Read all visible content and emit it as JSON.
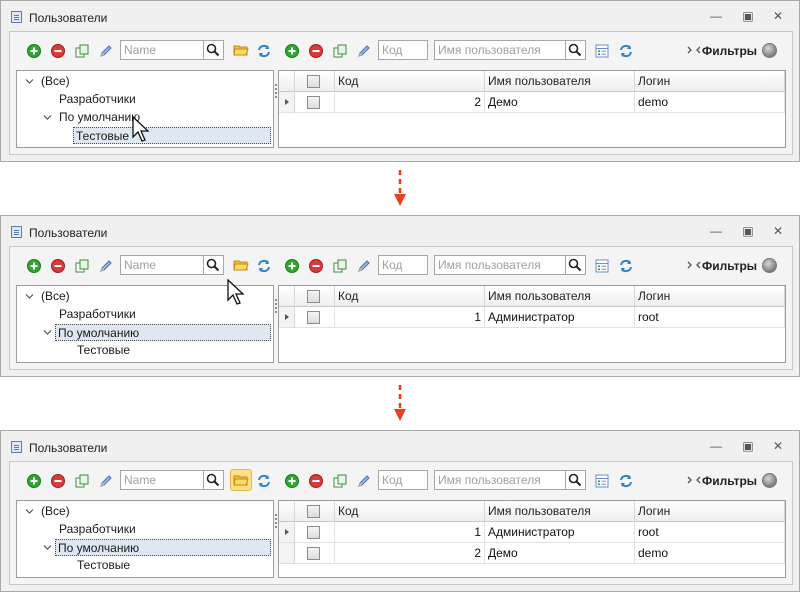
{
  "window_title": "Пользователи",
  "window_controls": [
    "minimize-icon",
    "restore-icon",
    "close-icon"
  ],
  "left_toolbar": {
    "search_placeholder": "Name",
    "icons": [
      "add-icon",
      "delete-icon",
      "copy-icon",
      "edit-icon",
      "search-icon",
      "folder-icon",
      "refresh-icon"
    ]
  },
  "right_toolbar": {
    "code_placeholder": "Код",
    "username_placeholder": "Имя пользователя",
    "filters_label": "Фильтры",
    "icons": [
      "add-icon",
      "delete-icon",
      "copy-icon",
      "edit-icon",
      "search-icon",
      "columns-icon",
      "refresh-icon",
      "collapse-icon",
      "status-ball-icon"
    ]
  },
  "tree": {
    "all": "(Все)",
    "developers": "Разработчики",
    "default": "По умолчанию",
    "test": "Тестовые"
  },
  "grid": {
    "columns": [
      "Код",
      "Имя пользователя",
      "Логин"
    ]
  },
  "screens": [
    {
      "selected_tree_item": "Тестовые",
      "folder_button_highlighted": false,
      "rows": [
        {
          "code": "2",
          "name": "Демо",
          "login": "demo"
        }
      ]
    },
    {
      "selected_tree_item": "По умолчанию",
      "folder_button_highlighted": false,
      "rows": [
        {
          "code": "1",
          "name": "Администратор",
          "login": "root"
        }
      ]
    },
    {
      "selected_tree_item": "По умолчанию",
      "folder_button_highlighted": true,
      "rows": [
        {
          "code": "1",
          "name": "Администратор",
          "login": "root"
        },
        {
          "code": "2",
          "name": "Демо",
          "login": "demo"
        }
      ]
    }
  ],
  "colors": {
    "add": "#2fa62f",
    "delete": "#d93a3a",
    "arrow": "#e8401c",
    "highlight": "#ffe08a"
  }
}
